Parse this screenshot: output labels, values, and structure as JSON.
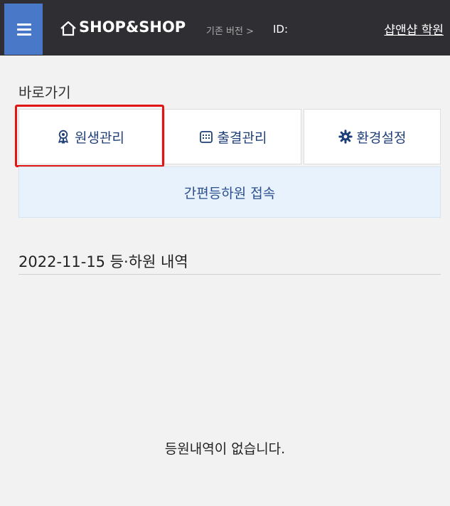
{
  "header": {
    "brand": "SHOP&SHOP",
    "legacy_link": "기존 버전 >",
    "id_label": "ID:",
    "school_name": "샵앤샵 학원"
  },
  "shortcuts": {
    "title": "바로가기",
    "items": [
      {
        "label": "원생관리",
        "icon": "student-badge-icon",
        "highlighted": true
      },
      {
        "label": "출결관리",
        "icon": "calendar-icon"
      },
      {
        "label": "환경설정",
        "icon": "gear-icon"
      }
    ],
    "quick_access": "간편등하원 접속"
  },
  "history": {
    "title": "2022-11-15 등·하원 내역",
    "empty_message": "등원내역이 없습니다."
  },
  "colors": {
    "header_bg": "#2f2f33",
    "menu_button_bg": "#4a78c9",
    "tile_text": "#1f3f78",
    "quick_bg": "#e8f2fc",
    "highlight_border": "#e21515"
  }
}
